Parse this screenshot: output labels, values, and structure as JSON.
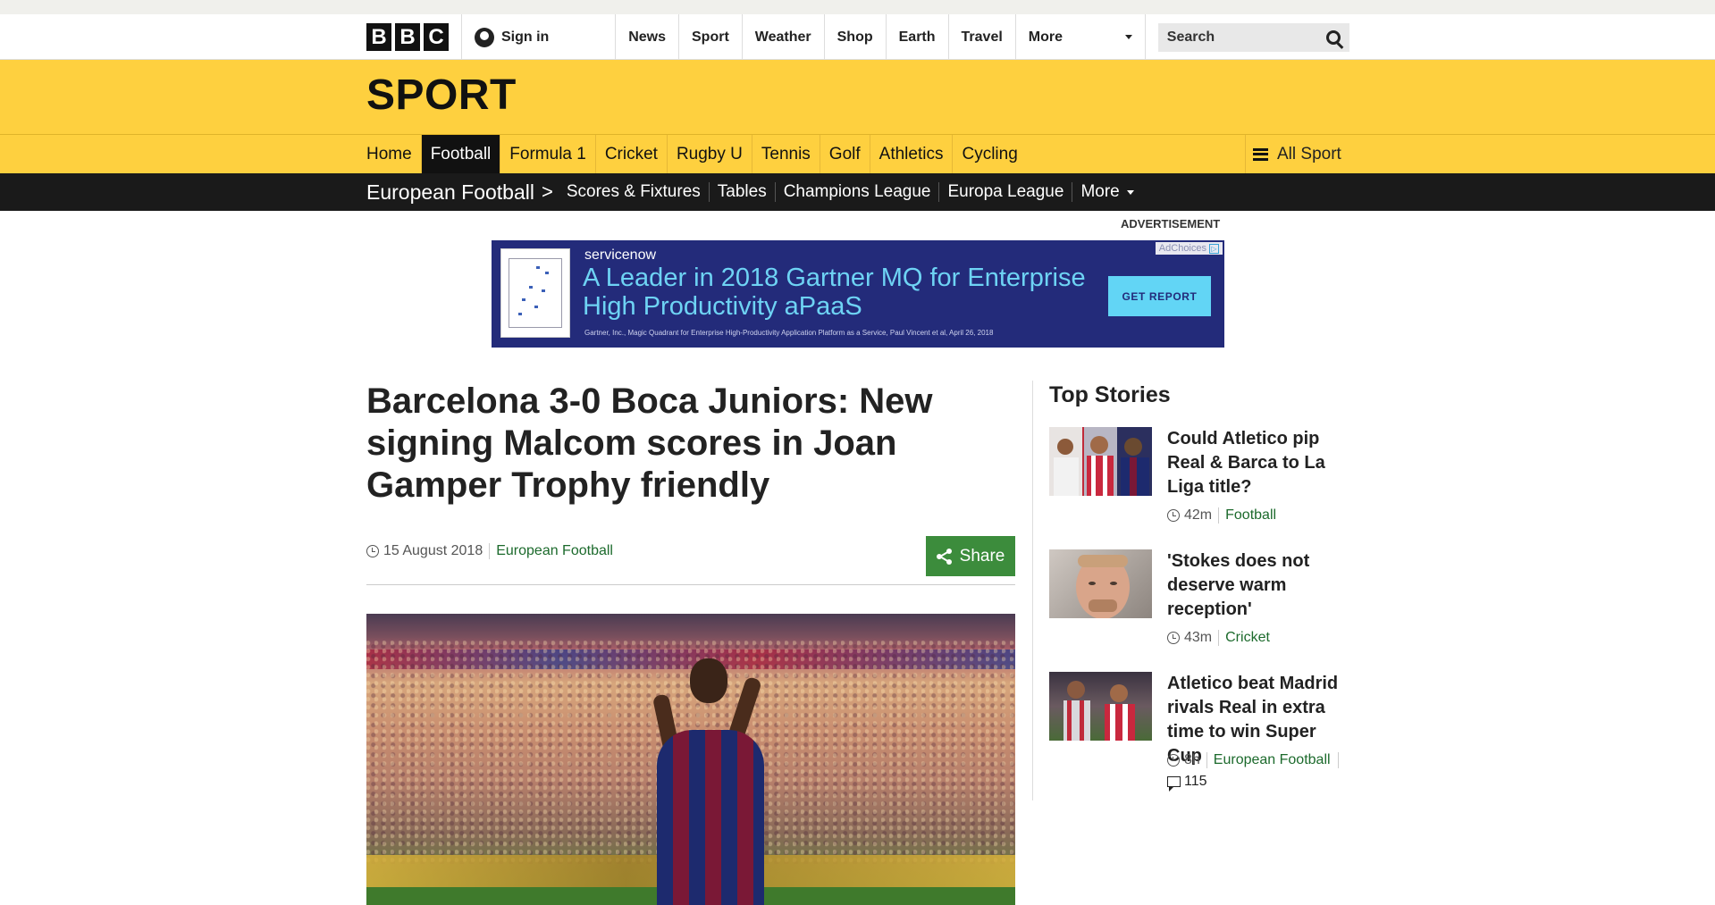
{
  "global": {
    "logo": [
      "B",
      "B",
      "C"
    ],
    "signin": "Sign in",
    "nav": [
      "News",
      "Sport",
      "Weather",
      "Shop",
      "Earth",
      "Travel"
    ],
    "more": "More",
    "search_placeholder": "Search"
  },
  "sport": {
    "title": "SPORT",
    "nav": [
      "Home",
      "Football",
      "Formula 1",
      "Cricket",
      "Rugby U",
      "Tennis",
      "Golf",
      "Athletics",
      "Cycling"
    ],
    "active": "Football",
    "all_sport": "All Sport"
  },
  "subnav": {
    "section": "European Football",
    "links": [
      "Scores & Fixtures",
      "Tables",
      "Champions League",
      "Europa League"
    ],
    "more": "More"
  },
  "ad": {
    "label": "ADVERTISEMENT",
    "brand": "servicenow",
    "headline_1": "A Leader in 2018 Gartner MQ for Enterprise",
    "headline_2": "High Productivity aPaaS",
    "fine_print": "Gartner, Inc., Magic Quadrant for Enterprise High-Productivity Application Platform as a Service, Paul Vincent et al, April 26, 2018",
    "cta": "GET REPORT",
    "adchoices": "AdChoices"
  },
  "article": {
    "headline": "Barcelona 3-0 Boca Juniors: New signing Malcom scores in Joan Gamper Trophy friendly",
    "date": "15 August 2018",
    "section": "European Football",
    "share": "Share"
  },
  "top_stories": {
    "title": "Top Stories",
    "items": [
      {
        "title": "Could Atletico pip Real & Barca to La Liga title?",
        "time": "42m",
        "section": "Football"
      },
      {
        "title": "'Stokes does not deserve warm reception'",
        "time": "43m",
        "section": "Cricket"
      },
      {
        "title": "Atletico beat Madrid rivals Real in extra time to win Super Cup",
        "time": "8h",
        "section": "European Football",
        "comments": "115"
      }
    ]
  },
  "colors": {
    "sport_yellow": "#fed03f",
    "subnav_black": "#1a1a1a",
    "link_green": "#1c6a2c",
    "share_green": "#3c8c3c",
    "ad_navy": "#232b7a",
    "ad_cyan": "#62d5f5"
  }
}
